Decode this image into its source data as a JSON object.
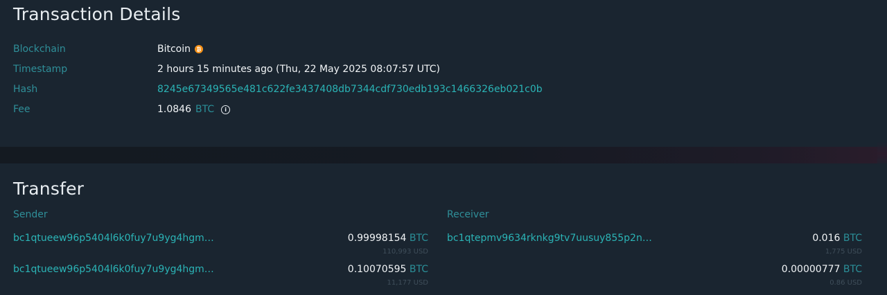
{
  "details": {
    "title": "Transaction Details",
    "blockchain_label": "Blockchain",
    "blockchain_value": "Bitcoin",
    "blockchain_icon": "bitcoin-icon",
    "timestamp_label": "Timestamp",
    "timestamp_value": "2 hours 15 minutes ago (Thu, 22 May 2025 08:07:57 UTC)",
    "hash_label": "Hash",
    "hash_value": "8245e67349565e481c622fe3437408db7344cdf730edb193c1466326eb021c0b",
    "fee_label": "Fee",
    "fee_amount": "1.0846",
    "fee_currency": "BTC",
    "fee_info_icon": "info-icon"
  },
  "transfer": {
    "title": "Transfer",
    "sender_header": "Sender",
    "receiver_header": "Receiver",
    "senders": [
      {
        "address": "bc1qtueew96p5404l6k0fuy7u9yg4hgm…",
        "amount": "0.99998154",
        "currency": "BTC",
        "usd": "110,993 USD"
      },
      {
        "address": "bc1qtueew96p5404l6k0fuy7u9yg4hgm…",
        "amount": "0.10070595",
        "currency": "BTC",
        "usd": "11,177 USD"
      }
    ],
    "receivers": [
      {
        "address": "bc1qtepmv9634rknkg9tv7uusuy855p2n…",
        "amount": "0.016",
        "currency": "BTC",
        "usd": "1,775 USD"
      },
      {
        "address": "",
        "amount": "0.00000777",
        "currency": "BTC",
        "usd": "0.86 USD"
      }
    ]
  },
  "colors": {
    "background": "#1a2530",
    "label": "#2f8f99",
    "link": "#2bb4b6",
    "text": "#f1f4f6",
    "bitcoin": "#f7931a"
  }
}
